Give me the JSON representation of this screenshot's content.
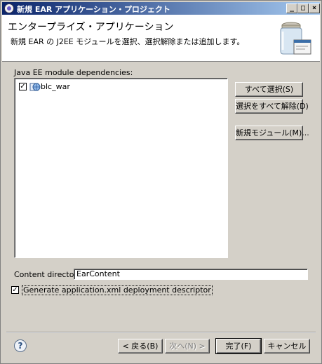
{
  "window": {
    "title": "新規 EAR アプリケーション・プロジェクト",
    "minimize": "_",
    "maximize": "□",
    "close": "×"
  },
  "banner": {
    "title": "エンタープライズ・アプリケーション",
    "description": "新規 EAR の J2EE モジュールを選択、選択解除または追加します。"
  },
  "modules": {
    "label": "Java EE module dependencies:",
    "items": [
      {
        "name": "blc_war",
        "checked": true,
        "check_mark": "✓"
      }
    ]
  },
  "buttons": {
    "select_all": "すべて選択(S)",
    "deselect_all": "選択をすべて解除(D)",
    "new_module": "新規モジュール(M)..."
  },
  "content_directory": {
    "label": "Content directory:",
    "value": "EarContent"
  },
  "generate_descriptor": {
    "label": "Generate application.xml deployment descriptor",
    "checked": true,
    "check_mark": "✓"
  },
  "footer": {
    "help": "?",
    "back": "< 戻る(B)",
    "next": "次へ(N) >",
    "finish": "完了(F)",
    "cancel": "キャンセル"
  }
}
